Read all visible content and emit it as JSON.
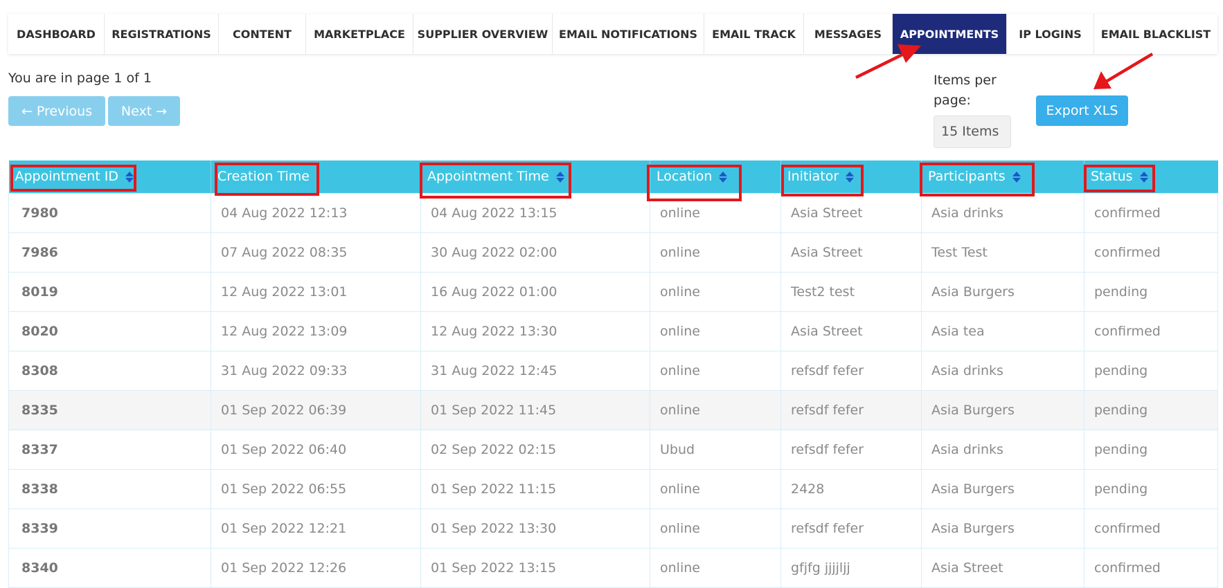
{
  "tabs": [
    {
      "label": "DASHBOARD"
    },
    {
      "label": "REGISTRATIONS"
    },
    {
      "label": "CONTENT"
    },
    {
      "label": "MARKETPLACE"
    },
    {
      "label": "SUPPLIER OVERVIEW"
    },
    {
      "label": "EMAIL NOTIFICATIONS"
    },
    {
      "label": "EMAIL TRACK"
    },
    {
      "label": "MESSAGES"
    },
    {
      "label": "APPOINTMENTS",
      "active": true
    },
    {
      "label": "IP LOGINS"
    },
    {
      "label": "EMAIL BLACKLIST"
    }
  ],
  "pagination": {
    "info": "You are in page 1 of 1",
    "previous_label": "← Previous",
    "next_label": "Next →"
  },
  "items_per_page": {
    "label": "Items per page:",
    "value": "15 Items"
  },
  "export_label": "Export XLS",
  "table": {
    "columns": [
      "Appointment ID",
      "Creation Time",
      "Appointment Time",
      "Location",
      "Initiator",
      "Participants",
      "Status"
    ],
    "rows": [
      [
        "7980",
        "04 Aug 2022 12:13",
        "04 Aug 2022 13:15",
        "online",
        "Asia Street",
        "Asia drinks",
        "confirmed"
      ],
      [
        "7986",
        "07 Aug 2022 08:35",
        "30 Aug 2022 02:00",
        "online",
        "Asia Street",
        "Test Test",
        "confirmed"
      ],
      [
        "8019",
        "12 Aug 2022 13:01",
        "16 Aug 2022 01:00",
        "online",
        "Test2 test",
        "Asia Burgers",
        "pending"
      ],
      [
        "8020",
        "12 Aug 2022 13:09",
        "12 Aug 2022 13:30",
        "online",
        "Asia Street",
        "Asia tea",
        "confirmed"
      ],
      [
        "8308",
        "31 Aug 2022 09:33",
        "31 Aug 2022 12:45",
        "online",
        "refsdf fefer",
        "Asia drinks",
        "pending"
      ],
      [
        "8335",
        "01 Sep 2022 06:39",
        "01 Sep 2022 11:45",
        "online",
        "refsdf fefer",
        "Asia Burgers",
        "pending"
      ],
      [
        "8337",
        "01 Sep 2022 06:40",
        "02 Sep 2022 02:15",
        "Ubud",
        "refsdf fefer",
        "Asia drinks",
        "pending"
      ],
      [
        "8338",
        "01 Sep 2022 06:55",
        "01 Sep 2022 11:15",
        "online",
        "2428",
        "Asia Burgers",
        "pending"
      ],
      [
        "8339",
        "01 Sep 2022 12:21",
        "01 Sep 2022 13:30",
        "online",
        "refsdf fefer",
        "Asia Burgers",
        "confirmed"
      ],
      [
        "8340",
        "01 Sep 2022 12:26",
        "01 Sep 2022 13:15",
        "online",
        "gfjfg jjjjljj",
        "Asia Street",
        "confirmed"
      ]
    ]
  },
  "colors": {
    "active_tab": "#1e2b7a",
    "header_bg": "#3ec4e2",
    "button_light": "#88cfee",
    "export_button": "#38aeea",
    "annotation": "#e3171c"
  }
}
